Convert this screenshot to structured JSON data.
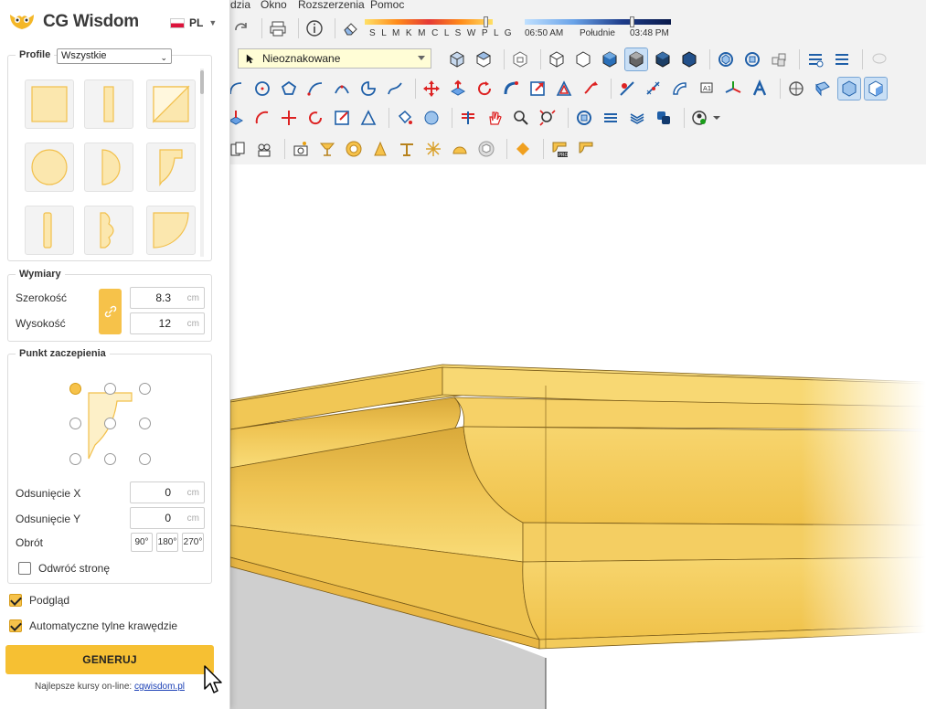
{
  "menubar": {
    "items": [
      "dzia",
      "Okno",
      "Rozszerzenia",
      "Pomoc"
    ]
  },
  "shadows": {
    "months": "S L M K M C L S W P L G",
    "time_start": "06:50 AM",
    "time_mid": "Południe",
    "time_end": "03:48 PM",
    "month_position": 0.94,
    "time_position": 0.73
  },
  "toolbar": {
    "tag_value": "Nieoznakowane"
  },
  "panel": {
    "brand": "CG Wisdom",
    "language": "PL",
    "profile": {
      "title": "Profile",
      "filter": "Wszystkie"
    },
    "dimensions": {
      "title": "Wymiary",
      "width_label": "Szerokość",
      "width_value": "8.3",
      "height_label": "Wysokość",
      "height_value": "12",
      "unit": "cm"
    },
    "anchor": {
      "title": "Punkt zaczepienia",
      "offset_x_label": "Odsunięcie X",
      "offset_x_value": "0",
      "offset_y_label": "Odsunięcie Y",
      "offset_y_value": "0",
      "unit": "cm",
      "rotation_label": "Obrót",
      "rot_90": "90°",
      "rot_180": "180°",
      "rot_270": "270°",
      "flip_label": "Odwróć stronę",
      "flip_checked": false
    },
    "preview_label": "Podgląd",
    "preview_checked": true,
    "auto_edges_label": "Automatyczne tylne krawędzie",
    "auto_edges_checked": true,
    "generate_label": "GENERUJ",
    "footer_text": "Najlepsze kursy on-line:",
    "footer_link": "cgwisdom.pl"
  },
  "colors": {
    "accent": "#f6c24a",
    "molding_light": "#fbe08a",
    "molding_mid": "#e8be4f",
    "molding_dark": "#c9952a",
    "wall": "#cfcfcf"
  }
}
